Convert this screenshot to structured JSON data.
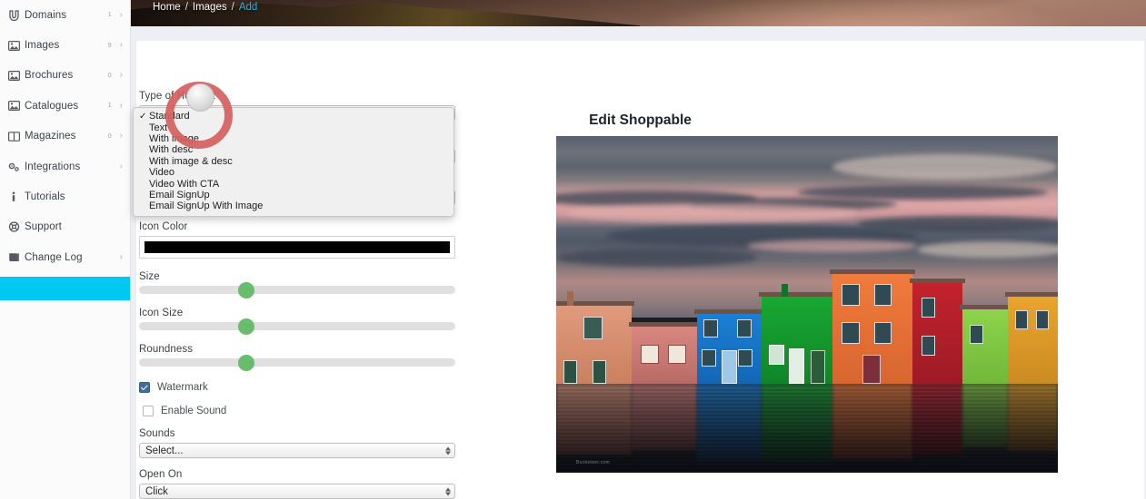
{
  "header": {
    "breadcrumb": [
      {
        "label": "Home",
        "active": false
      },
      {
        "label": "Images",
        "active": false
      },
      {
        "label": "Add",
        "active": true
      }
    ],
    "separator": "/",
    "accent_color": "#22b8f0"
  },
  "sidebar": {
    "highlight_color": "#00c8f0",
    "items": [
      {
        "label": "Domains",
        "icon": "magnet-icon",
        "badge": "1",
        "arrow": "›"
      },
      {
        "label": "Images",
        "icon": "image-icon",
        "badge": "9",
        "arrow": "›"
      },
      {
        "label": "Brochures",
        "icon": "image-icon",
        "badge": "0",
        "arrow": "›"
      },
      {
        "label": "Catalogues",
        "icon": "image-icon",
        "badge": "1",
        "arrow": "›"
      },
      {
        "label": "Magazines",
        "icon": "book-open-icon",
        "badge": "0",
        "arrow": "›"
      },
      {
        "label": "Integrations",
        "icon": "gears-icon",
        "badge": "",
        "arrow": "›"
      },
      {
        "label": "Tutorials",
        "icon": "info-icon",
        "badge": "",
        "arrow": ""
      },
      {
        "label": "Support",
        "icon": "life-ring-icon",
        "badge": "",
        "arrow": ""
      },
      {
        "label": "Change Log",
        "icon": "book-icon",
        "badge": "",
        "arrow": "›"
      }
    ]
  },
  "form": {
    "type_of_hotspot": {
      "label": "Type of HotSpot",
      "value": "Standard"
    },
    "dropdown": {
      "open": true,
      "selected": "Standard",
      "check_glyph": "✓",
      "options": [
        "Standard",
        "Text",
        "With image",
        "With desc",
        "With image & desc",
        "Video",
        "Video With CTA",
        "Email SignUp",
        "Email SignUp With Image"
      ]
    },
    "icon_color": {
      "label": "Icon Color",
      "value": "#000000"
    },
    "size": {
      "label": "Size",
      "percent": 34
    },
    "icon_size": {
      "label": "Icon Size",
      "percent": 34
    },
    "roundness": {
      "label": "Roundness",
      "percent": 34
    },
    "watermark": {
      "label": "Watermark",
      "checked": true
    },
    "enable_sound": {
      "label": "Enable Sound",
      "checked": false
    },
    "sounds": {
      "label": "Sounds",
      "value": "Select..."
    },
    "open_on": {
      "label": "Open On",
      "value": "Click"
    }
  },
  "preview": {
    "title": "Edit Shoppable",
    "image_alt": "Colorful houses of Burano at sunset reflected in canal water",
    "watermark_text": "Bucketeer.com"
  },
  "annotation": {
    "click_ring_color": "#d4605e",
    "cursor": "pointer-dot"
  }
}
